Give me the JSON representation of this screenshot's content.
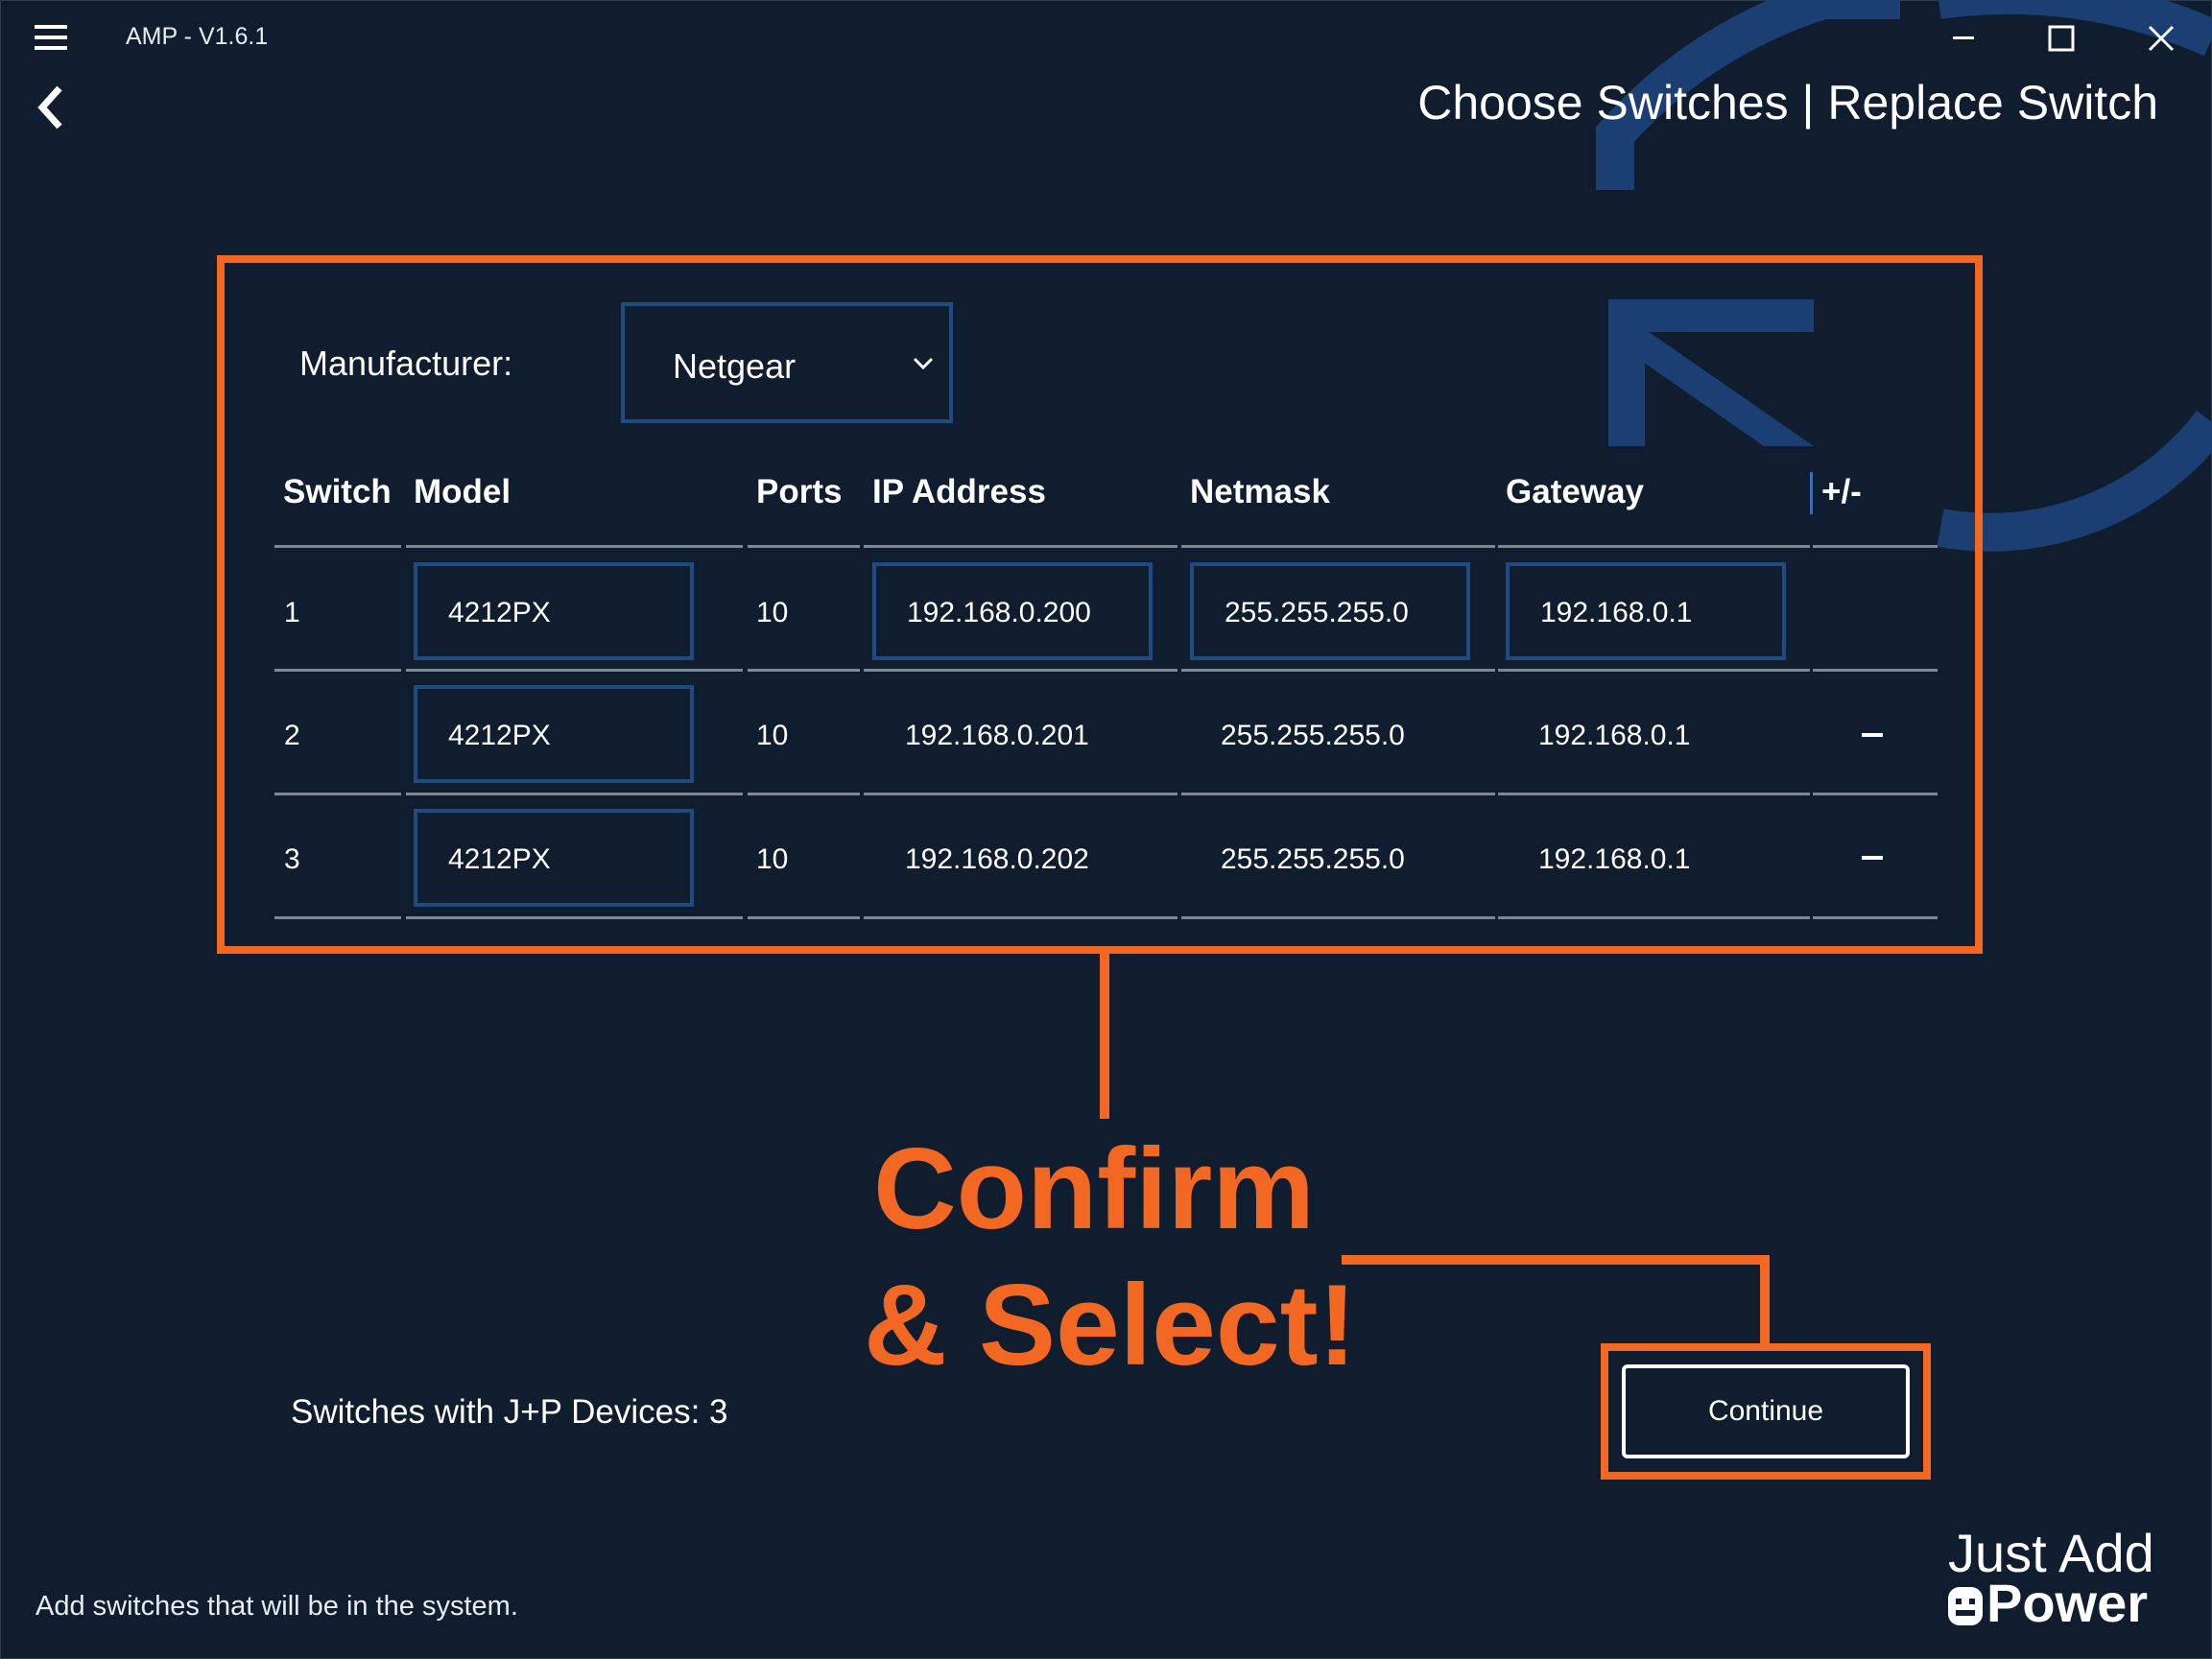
{
  "window": {
    "title": "AMP - V1.6.1",
    "icons": {
      "menu": "hamburger-menu-icon",
      "back": "back-chevron-icon",
      "minimize": "minimize-icon",
      "maximize": "maximize-icon",
      "close": "close-icon"
    }
  },
  "header": {
    "heading_part1": "Choose Switches",
    "separator": "|",
    "heading_part2": "Replace Switch"
  },
  "form": {
    "manufacturer_label": "Manufacturer:",
    "manufacturer_value": "Netgear"
  },
  "table": {
    "columns": [
      "Switch",
      "Model",
      "Ports",
      "IP Address",
      "Netmask",
      "Gateway",
      "+/-"
    ],
    "rows": [
      {
        "switch": "1",
        "model": "4212PX",
        "ports": "10",
        "ip": "192.168.0.200",
        "netmask": "255.255.255.0",
        "gateway": "192.168.0.1"
      },
      {
        "switch": "2",
        "model": "4212PX",
        "ports": "10",
        "ip": "192.168.0.201",
        "netmask": "255.255.255.0",
        "gateway": "192.168.0.1"
      },
      {
        "switch": "3",
        "model": "4212PX",
        "ports": "10",
        "ip": "192.168.0.202",
        "netmask": "255.255.255.0",
        "gateway": "192.168.0.1"
      }
    ]
  },
  "annotation": {
    "line1": "Confirm",
    "line2": "& Select!",
    "color": "#f26722"
  },
  "status": {
    "switch_count": "Switches with J+P Devices: 3"
  },
  "actions": {
    "continue_label": "Continue"
  },
  "footer": {
    "hint": "Add switches that will be in the system."
  },
  "logo": {
    "line1": "Just Add",
    "line2": "Power"
  },
  "colors": {
    "background": "#0f1d2e",
    "accent_orange": "#f26722",
    "field_border": "#1f4a82",
    "deco_blue": "#1b3f72"
  }
}
